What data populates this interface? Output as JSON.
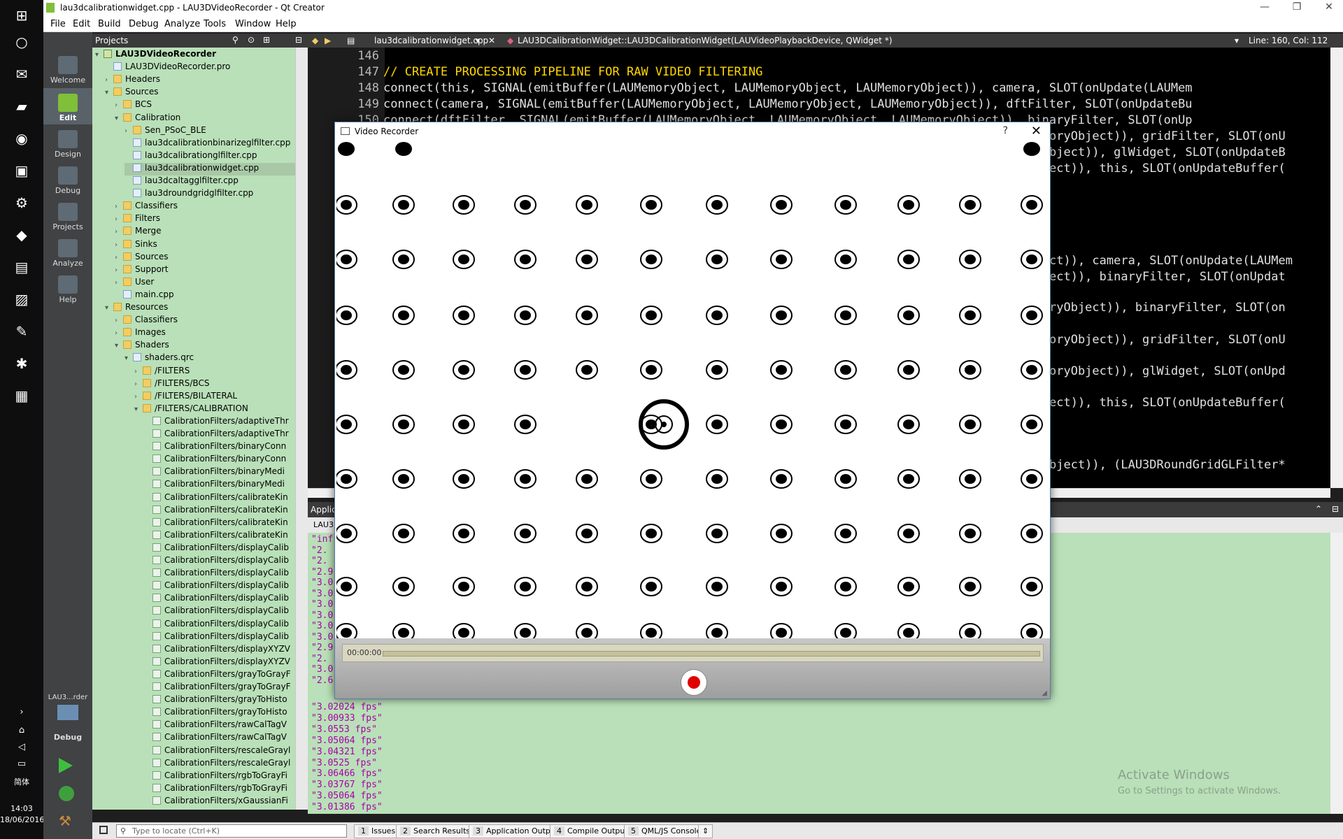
{
  "taskbar": {
    "time": "14:03",
    "date": "18/06/2016",
    "ime": "简体"
  },
  "window": {
    "title": "lau3dcalibrationwidget.cpp - LAU3DVideoRecorder - Qt Creator"
  },
  "menu": [
    "File",
    "Edit",
    "Build",
    "Debug",
    "Analyze",
    "Tools",
    "Window",
    "Help"
  ],
  "modes": [
    {
      "label": "Welcome"
    },
    {
      "label": "Edit"
    },
    {
      "label": "Design"
    },
    {
      "label": "Debug"
    },
    {
      "label": "Projects"
    },
    {
      "label": "Analyze"
    },
    {
      "label": "Help"
    }
  ],
  "kit": {
    "name": "LAU3...rder",
    "mode": "Debug"
  },
  "projects": {
    "header": "Projects",
    "tree": [
      {
        "label": "LAU3DVideoRecorder",
        "kind": "proj"
      },
      {
        "label": "LAU3DVideoRecorder.pro",
        "kind": "file"
      },
      {
        "label": "Headers",
        "kind": "folder"
      },
      {
        "label": "Sources",
        "kind": "folder"
      },
      {
        "label": "BCS",
        "kind": "folder"
      },
      {
        "label": "Calibration",
        "kind": "folder"
      },
      {
        "label": "Sen_PSoC_BLE",
        "kind": "folder"
      },
      {
        "label": "lau3dcalibrationbinarizeglfilter.cpp",
        "kind": "file"
      },
      {
        "label": "lau3dcalibrationglfilter.cpp",
        "kind": "file"
      },
      {
        "label": "lau3dcalibrationwidget.cpp",
        "kind": "file"
      },
      {
        "label": "lau3dcaltagglfilter.cpp",
        "kind": "file"
      },
      {
        "label": "lau3droundgridglfilter.cpp",
        "kind": "file"
      },
      {
        "label": "Classifiers",
        "kind": "folder"
      },
      {
        "label": "Filters",
        "kind": "folder"
      },
      {
        "label": "Merge",
        "kind": "folder"
      },
      {
        "label": "Sinks",
        "kind": "folder"
      },
      {
        "label": "Sources",
        "kind": "folder"
      },
      {
        "label": "Support",
        "kind": "folder"
      },
      {
        "label": "User",
        "kind": "folder"
      },
      {
        "label": "main.cpp",
        "kind": "file"
      },
      {
        "label": "Resources",
        "kind": "folder"
      },
      {
        "label": "Classifiers",
        "kind": "folder"
      },
      {
        "label": "Images",
        "kind": "folder"
      },
      {
        "label": "Shaders",
        "kind": "folder"
      },
      {
        "label": "shaders.qrc",
        "kind": "file"
      },
      {
        "label": "/FILTERS",
        "kind": "folder"
      },
      {
        "label": "/FILTERS/BCS",
        "kind": "folder"
      },
      {
        "label": "/FILTERS/BILATERAL",
        "kind": "folder"
      },
      {
        "label": "/FILTERS/CALIBRATION",
        "kind": "folder"
      },
      {
        "label": "CalibrationFilters/adaptiveThr",
        "kind": "gl"
      },
      {
        "label": "CalibrationFilters/adaptiveThr",
        "kind": "gl"
      },
      {
        "label": "CalibrationFilters/binaryConn",
        "kind": "gl"
      },
      {
        "label": "CalibrationFilters/binaryConn",
        "kind": "gl"
      },
      {
        "label": "CalibrationFilters/binaryMedi",
        "kind": "gl"
      },
      {
        "label": "CalibrationFilters/binaryMedi",
        "kind": "gl"
      },
      {
        "label": "CalibrationFilters/calibrateKin",
        "kind": "gl"
      },
      {
        "label": "CalibrationFilters/calibrateKin",
        "kind": "gl"
      },
      {
        "label": "CalibrationFilters/calibrateKin",
        "kind": "gl"
      },
      {
        "label": "CalibrationFilters/calibrateKin",
        "kind": "gl"
      },
      {
        "label": "CalibrationFilters/displayCalib",
        "kind": "gl"
      },
      {
        "label": "CalibrationFilters/displayCalib",
        "kind": "gl"
      },
      {
        "label": "CalibrationFilters/displayCalib",
        "kind": "gl"
      },
      {
        "label": "CalibrationFilters/displayCalib",
        "kind": "gl"
      },
      {
        "label": "CalibrationFilters/displayCalib",
        "kind": "gl"
      },
      {
        "label": "CalibrationFilters/displayCalib",
        "kind": "gl"
      },
      {
        "label": "CalibrationFilters/displayCalib",
        "kind": "gl"
      },
      {
        "label": "CalibrationFilters/displayCalib",
        "kind": "gl"
      },
      {
        "label": "CalibrationFilters/displayXYZV",
        "kind": "gl"
      },
      {
        "label": "CalibrationFilters/displayXYZV",
        "kind": "gl"
      },
      {
        "label": "CalibrationFilters/grayToGrayF",
        "kind": "gl"
      },
      {
        "label": "CalibrationFilters/grayToGrayF",
        "kind": "gl"
      },
      {
        "label": "CalibrationFilters/grayToHisto",
        "kind": "gl"
      },
      {
        "label": "CalibrationFilters/grayToHisto",
        "kind": "gl"
      },
      {
        "label": "CalibrationFilters/rawCalTagV",
        "kind": "gl"
      },
      {
        "label": "CalibrationFilters/rawCalTagV",
        "kind": "gl"
      },
      {
        "label": "CalibrationFilters/rescaleGrayl",
        "kind": "gl"
      },
      {
        "label": "CalibrationFilters/rescaleGrayl",
        "kind": "gl"
      },
      {
        "label": "CalibrationFilters/rgbToGrayFi",
        "kind": "gl"
      },
      {
        "label": "CalibrationFilters/rgbToGrayFi",
        "kind": "gl"
      },
      {
        "label": "CalibrationFilters/xGaussianFi",
        "kind": "gl"
      }
    ]
  },
  "editor": {
    "file_tab": "lau3dcalibrationwidget.cpp",
    "symbol": "LAU3DCalibrationWidget::LAU3DCalibrationWidget(LAUVideoPlaybackDevice, QWidget *)",
    "position": "Line: 160, Col: 112",
    "line_numbers": [
      "146",
      "147",
      "148",
      "149",
      "150"
    ],
    "comment": "// CREATE PROCESSING PIPELINE FOR RAW VIDEO FILTERING",
    "line148": "connect(this, SIGNAL(emitBuffer(LAUMemoryObject, LAUMemoryObject, LAUMemoryObject)), camera, SLOT(onUpdate(LAUMem",
    "line149": "connect(camera, SIGNAL(emitBuffer(LAUMemoryObject, LAUMemoryObject, LAUMemoryObject)), dftFilter, SLOT(onUpdateBu",
    "line150": "connect(dftFilter, SIGNAL(emitBuffer(LAUMemoryObject, LAUMemoryObject, LAUMemoryObject)), binaryFilter, SLOT(onUp",
    "visible_right": [
      "oryObject)), gridFilter, SLOT(onU",
      "bject)), glWidget, SLOT(onUpdateB",
      "ect)), this, SLOT(onUpdateBuffer(",
      "ct)), camera, SLOT(onUpdate(LAUMem",
      "ect)), binaryFilter, SLOT(onUpdat",
      "ryObject)), binaryFilter, SLOT(on",
      "oryObject)), gridFilter, SLOT(onU",
      "oryObject)), glWidget, SLOT(onUpd",
      "ect)), this, SLOT(onUpdateBuffer(",
      "bject)), (LAU3DRoundGridGLFilter*"
    ]
  },
  "output": {
    "header": "Applica",
    "tab": "LAU3",
    "lines_left": [
      "\"inf",
      "\"2.",
      "\"2.",
      "\"2.9",
      "\"3.0",
      "\"3.0",
      "\"3.0",
      "\"3.0",
      "\"3.0",
      "\"3.0",
      "\"2.9",
      "\"2.",
      "\"3.0",
      "\"2.6"
    ],
    "lines": [
      "\"3.02024 fps\"",
      "\"3.00933 fps\"",
      "\"3.0553 fps\"",
      "\"3.05064 fps\"",
      "\"3.04321 fps\"",
      "\"3.0525 fps\"",
      "\"3.06466 fps\"",
      "\"3.03767 fps\"",
      "\"3.05064 fps\"",
      "\"3.01386 fps\""
    ],
    "watermark_title": "Activate Windows",
    "watermark_sub": "Go to Settings to activate Windows."
  },
  "status": {
    "locator_placeholder": "Type to locate (Ctrl+K)",
    "tabs": [
      {
        "num": "1",
        "label": "Issues"
      },
      {
        "num": "2",
        "label": "Search Results"
      },
      {
        "num": "3",
        "label": "Application Output"
      },
      {
        "num": "4",
        "label": "Compile Output"
      },
      {
        "num": "5",
        "label": "QML/JS Console"
      }
    ]
  },
  "dialog": {
    "title": "Video Recorder",
    "help": "?",
    "close": "✕",
    "timecode": "00:00:00",
    "record_color": "#e00000"
  }
}
